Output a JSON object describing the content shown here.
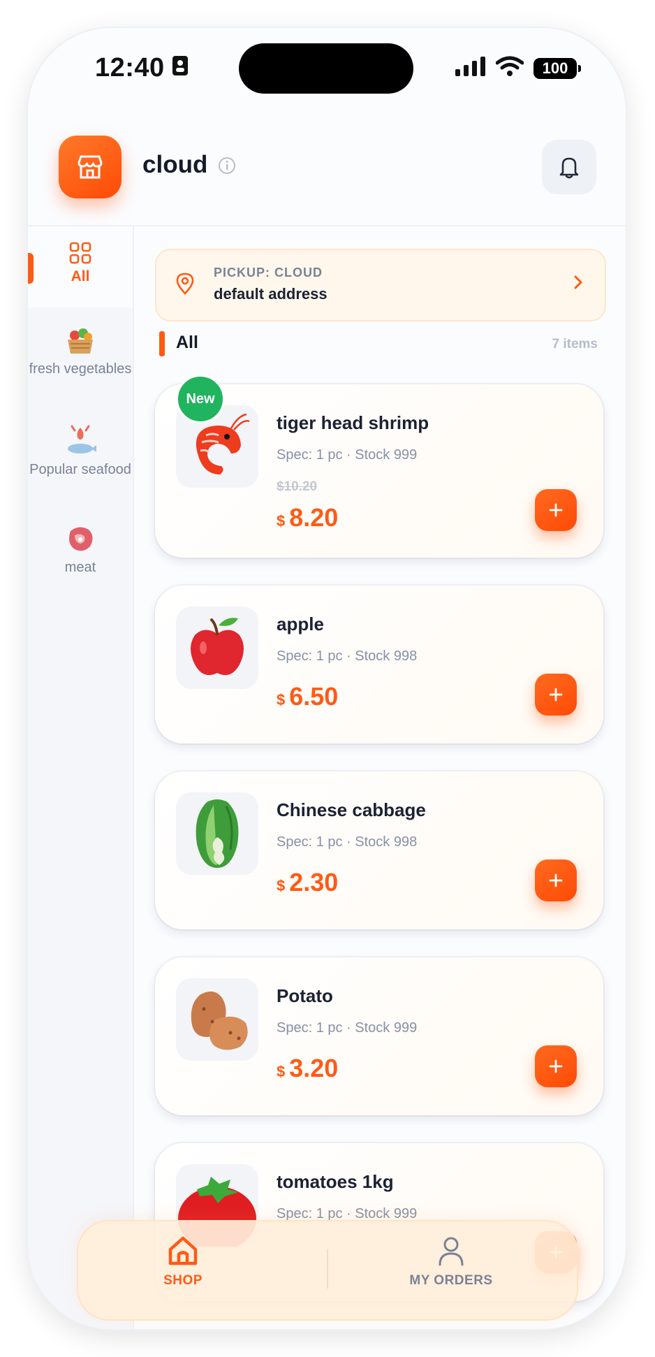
{
  "status_bar": {
    "time": "12:40",
    "battery": "100"
  },
  "header": {
    "store_name": "cloud"
  },
  "sidebar": {
    "items": [
      {
        "label": "All",
        "icon": "grid-icon",
        "active": true
      },
      {
        "label": "fresh vegetables",
        "icon": "vegetable-basket-icon",
        "active": false
      },
      {
        "label": "Popular seafood",
        "icon": "seafood-icon",
        "active": false
      },
      {
        "label": "meat",
        "icon": "meat-icon",
        "active": false
      }
    ]
  },
  "pickup": {
    "label": "PICKUP: CLOUD",
    "address": "default address"
  },
  "section": {
    "title": "All",
    "count": "7 items"
  },
  "products": [
    {
      "name": "tiger head shrimp",
      "spec": "Spec: 1 pc · Stock 999",
      "old_price": "$10.20",
      "currency": "$",
      "price": "8.20",
      "badge": "New",
      "icon": "shrimp-icon"
    },
    {
      "name": "apple",
      "spec": "Spec: 1 pc · Stock 998",
      "currency": "$",
      "price": "6.50",
      "icon": "apple-icon"
    },
    {
      "name": "Chinese cabbage",
      "spec": "Spec: 1 pc · Stock 998",
      "currency": "$",
      "price": "2.30",
      "icon": "cabbage-icon"
    },
    {
      "name": "Potato",
      "spec": "Spec: 1 pc · Stock 999",
      "currency": "$",
      "price": "3.20",
      "icon": "potato-icon"
    },
    {
      "name": "tomatoes 1kg",
      "spec": "Spec: 1 pc · Stock 999",
      "currency": "$",
      "price": "",
      "icon": "tomato-icon"
    }
  ],
  "bottom_nav": {
    "items": [
      {
        "label": "SHOP",
        "icon": "home-icon",
        "active": true
      },
      {
        "label": "MY ORDERS",
        "icon": "user-icon",
        "active": false
      }
    ]
  },
  "colors": {
    "accent": "#ff5a14",
    "new_badge": "#1fb45d",
    "text_dark": "#1c2233",
    "text_muted": "#8890a4"
  }
}
